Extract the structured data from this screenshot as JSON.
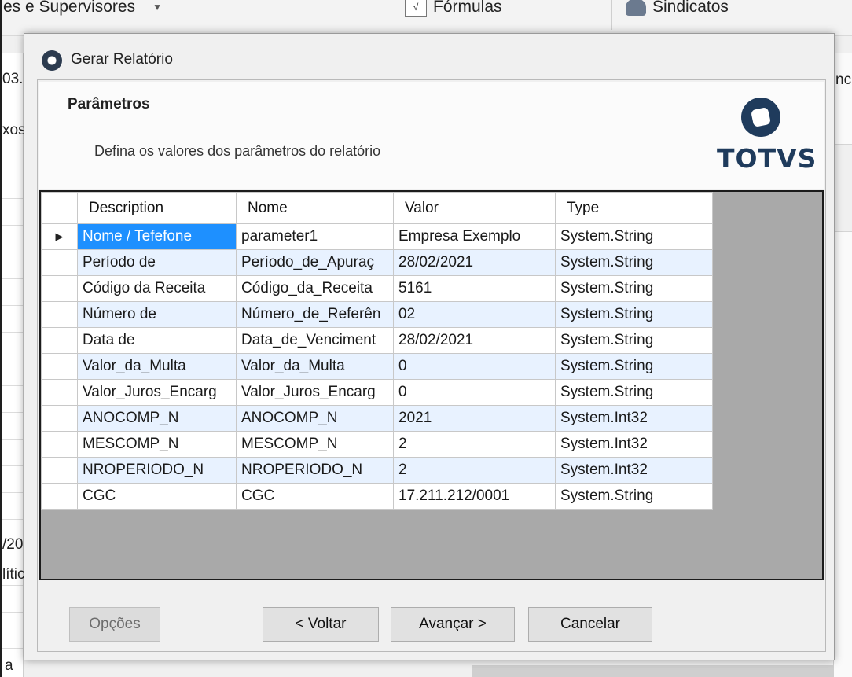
{
  "background": {
    "menu_label": "es e Supervisores",
    "toolbar": {
      "formulas_label": "Fórmulas",
      "formulas_icon": "formula-icon",
      "sindicatos_label": "Sindicatos",
      "sindicatos_icon": "union-icon"
    },
    "fragments": {
      "f1": "03.",
      "f2": "xos",
      "f3": "/20",
      "f4": "lític",
      "f5": "a",
      "f6": "ncia"
    }
  },
  "dialog": {
    "title": "Gerar Relatório",
    "header": {
      "title": "Parâmetros",
      "description": "Defina os valores dos parâmetros do relatório",
      "logo_text": "TOTVS"
    },
    "grid": {
      "columns": [
        "Description",
        "Nome",
        "Valor",
        "Type"
      ],
      "current_row_marker": "▶",
      "rows": [
        {
          "description": "Nome / Tefefone",
          "nome": "parameter1",
          "valor": "Empresa Exemplo",
          "type": "System.String"
        },
        {
          "description": "Período de",
          "nome": "Período_de_Apuraç",
          "valor": "28/02/2021",
          "type": "System.String"
        },
        {
          "description": "Código da Receita",
          "nome": "Código_da_Receita",
          "valor": "5161",
          "type": "System.String"
        },
        {
          "description": "Número de",
          "nome": "Número_de_Referên",
          "valor": "02",
          "type": "System.String"
        },
        {
          "description": "Data de",
          "nome": "Data_de_Venciment",
          "valor": "28/02/2021",
          "type": "System.String"
        },
        {
          "description": "Valor_da_Multa",
          "nome": "Valor_da_Multa",
          "valor": "0",
          "type": "System.String"
        },
        {
          "description": "Valor_Juros_Encarg",
          "nome": "Valor_Juros_Encarg",
          "valor": "0",
          "type": "System.String"
        },
        {
          "description": "ANOCOMP_N",
          "nome": "ANOCOMP_N",
          "valor": "2021",
          "type": "System.Int32"
        },
        {
          "description": "MESCOMP_N",
          "nome": "MESCOMP_N",
          "valor": "2",
          "type": "System.Int32"
        },
        {
          "description": "NROPERIODO_N",
          "nome": "NROPERIODO_N",
          "valor": "2",
          "type": "System.Int32"
        },
        {
          "description": "CGC",
          "nome": "CGC",
          "valor": "17.211.212/0001",
          "type": "System.String"
        }
      ]
    },
    "buttons": {
      "options": "Opções",
      "back": "< Voltar",
      "next": "Avançar >",
      "cancel": "Cancelar"
    }
  }
}
